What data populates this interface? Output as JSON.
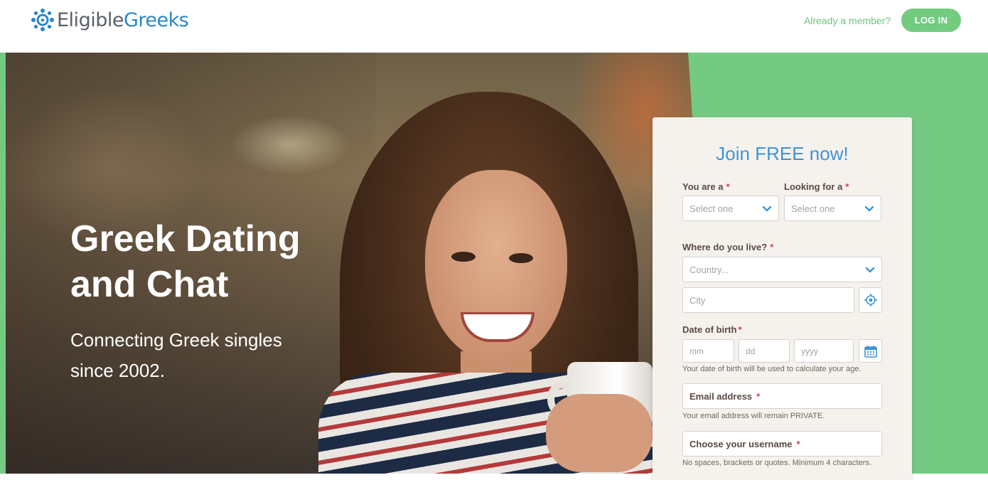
{
  "brand": {
    "name_part1": "Eligible",
    "name_part2": "Greeks"
  },
  "header": {
    "member_text": "Already a member?",
    "login_label": "LOG IN"
  },
  "hero": {
    "headline": "Greek Dating and Chat",
    "subline": "Connecting Greek singles since 2002."
  },
  "form": {
    "title": "Join FREE now!",
    "you_are_label": "You are a",
    "you_are_placeholder": "Select one",
    "looking_for_label": "Looking for a",
    "looking_for_placeholder": "Select one",
    "where_label": "Where do you live?",
    "country_placeholder": "Country...",
    "city_placeholder": "City",
    "dob_label": "Date of birth",
    "dob_mm": "mm",
    "dob_dd": "dd",
    "dob_yyyy": "yyyy",
    "dob_hint": "Your date of birth will be used to calculate your age.",
    "email_label": "Email address",
    "email_hint": "Your email address will remain PRIVATE.",
    "username_label": "Choose your username",
    "username_hint": "No spaces, brackets or quotes. Minimum 4 characters.",
    "required_mark": "*"
  },
  "colors": {
    "accent_green": "#73cb80",
    "brand_blue": "#2b86c7",
    "title_blue": "#3f94d6",
    "required_red": "#d0444b"
  },
  "icons": [
    "logo-flower-icon",
    "chevron-down-icon",
    "locate-icon",
    "calendar-icon"
  ]
}
